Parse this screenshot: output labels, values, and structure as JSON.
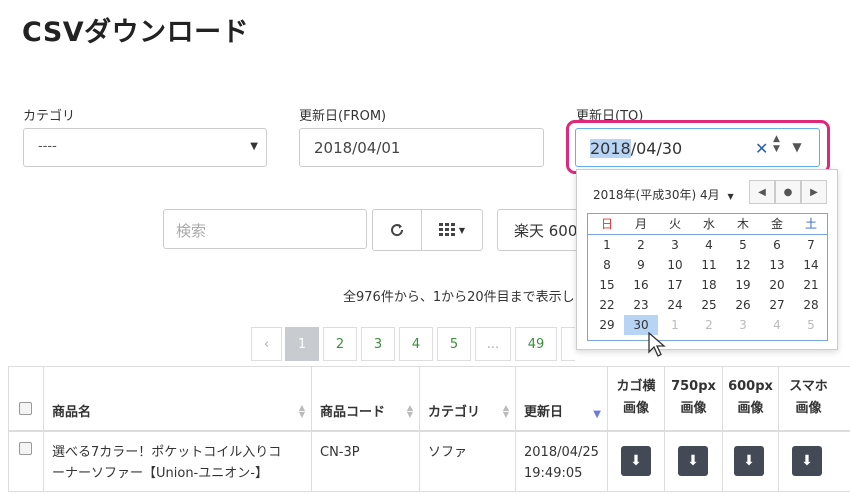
{
  "page": {
    "title": "CSVダウンロード"
  },
  "filters": {
    "category_label": "カテゴリ",
    "category_value": "----",
    "from_label": "更新日(FROM)",
    "from_value": "2018/04/01",
    "to_label": "更新日(TO)",
    "to_year_selected": "2018",
    "to_rest": "/04/30"
  },
  "toolbar": {
    "search_placeholder": "検索",
    "shop_label": "楽天 600"
  },
  "summary": "全976件から、1から20件目まで表示し",
  "pagination": [
    "‹",
    "1",
    "2",
    "3",
    "4",
    "5",
    "...",
    "49"
  ],
  "calendar": {
    "title": "2018年(平成30年) 4月",
    "weekdays": [
      "日",
      "月",
      "火",
      "水",
      "木",
      "金",
      "土"
    ],
    "weeks": [
      [
        "1",
        "2",
        "3",
        "4",
        "5",
        "6",
        "7"
      ],
      [
        "8",
        "9",
        "10",
        "11",
        "12",
        "13",
        "14"
      ],
      [
        "15",
        "16",
        "17",
        "18",
        "19",
        "20",
        "21"
      ],
      [
        "22",
        "23",
        "24",
        "25",
        "26",
        "27",
        "28"
      ],
      [
        "29",
        "30",
        "1",
        "2",
        "3",
        "4",
        "5"
      ]
    ],
    "selected": "30"
  },
  "table": {
    "headers": {
      "name": "商品名",
      "code": "商品コード",
      "category": "カテゴリ",
      "updated": "更新日",
      "cago_1": "カゴ横",
      "cago_2": "画像",
      "px750_1": "750px",
      "px750_2": "画像",
      "px600_1": "600px",
      "px600_2": "画像",
      "sp_1": "スマホ",
      "sp_2": "画像"
    },
    "row": {
      "name_line1": "選べる7カラー！ポケットコイル入りコ",
      "name_line2": "ーナーソファー【Union-ユニオン-】",
      "code": "CN-3P",
      "category": "ソファ",
      "date": "2018/04/25",
      "time": "19:49:05"
    }
  },
  "colors": {
    "highlight": "#e0287a",
    "selected_bg": "#b8d4f5",
    "pager_active": "#c8ccd1",
    "link_green": "#3a8f3a",
    "download_btn": "#444a55"
  }
}
